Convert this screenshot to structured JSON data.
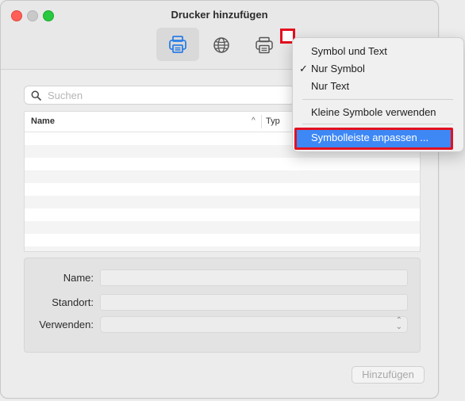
{
  "window": {
    "title": "Drucker hinzufügen"
  },
  "toolbar": {
    "items": [
      {
        "name": "printer-default-icon",
        "selected": true
      },
      {
        "name": "globe-ip-icon",
        "selected": false
      },
      {
        "name": "printer-windows-icon",
        "selected": false
      }
    ]
  },
  "search": {
    "placeholder": "Suchen",
    "value": ""
  },
  "table": {
    "columns": [
      {
        "label": "Name",
        "sort": "^"
      },
      {
        "label": "Typ"
      }
    ],
    "rows": []
  },
  "form": {
    "name_label": "Name:",
    "location_label": "Standort:",
    "use_label": "Verwenden:",
    "name_value": "",
    "location_value": "",
    "use_value": ""
  },
  "add_button": "Hinzufügen",
  "context_menu": {
    "items": [
      {
        "label": "Symbol und Text",
        "checked": false
      },
      {
        "label": "Nur Symbol",
        "checked": true
      },
      {
        "label": "Nur Text",
        "checked": false
      },
      {
        "label": "Kleine Symbole verwenden",
        "checked": false
      },
      {
        "label": "Symbolleiste anpassen ...",
        "highlighted": true
      }
    ],
    "check_mark": "✓"
  },
  "colors": {
    "highlight": "#3e88f6",
    "annotation_border": "#e3101f",
    "traffic_close": "#ff5f57",
    "traffic_min": "#c9c9c9",
    "traffic_max": "#28c840"
  }
}
